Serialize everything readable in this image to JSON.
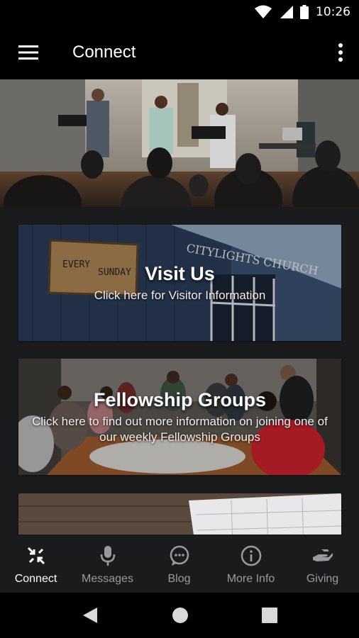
{
  "status_bar": {
    "time": "10:26"
  },
  "app_bar": {
    "title": "Connect"
  },
  "cards": [
    {
      "title": "Visit Us",
      "subtitle": "Click here for Visitor Information",
      "sign_line1": "EVERY",
      "sign_line2": "SUNDAY",
      "building_text": "CITYLIGHTS CHURCH"
    },
    {
      "title": "Fellowship Groups",
      "subtitle": "Click here to find out more information on joining one of our weekly Fellowship Groups"
    }
  ],
  "bottom_nav": [
    {
      "label": "Connect",
      "icon": "connect-icon",
      "active": true
    },
    {
      "label": "Messages",
      "icon": "microphone-icon",
      "active": false
    },
    {
      "label": "Blog",
      "icon": "chat-bubble-icon",
      "active": false
    },
    {
      "label": "More Info",
      "icon": "info-icon",
      "active": false
    },
    {
      "label": "Giving",
      "icon": "giving-hand-icon",
      "active": false
    }
  ],
  "colors": {
    "background": "#1a1b1d",
    "bar": "#000000",
    "inactive": "#9a9a9a",
    "active": "#ffffff"
  }
}
